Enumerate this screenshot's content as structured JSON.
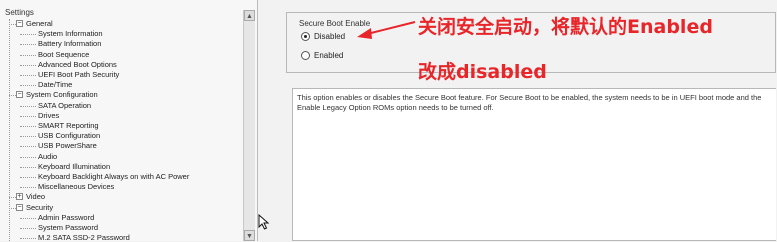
{
  "tree": {
    "title": "Settings",
    "items": [
      {
        "label": "General",
        "level": 0,
        "expander": "−"
      },
      {
        "label": "System Information",
        "level": 1
      },
      {
        "label": "Battery Information",
        "level": 1
      },
      {
        "label": "Boot Sequence",
        "level": 1
      },
      {
        "label": "Advanced Boot Options",
        "level": 1
      },
      {
        "label": "UEFI Boot Path Security",
        "level": 1
      },
      {
        "label": "Date/Time",
        "level": 1
      },
      {
        "label": "System Configuration",
        "level": 0,
        "expander": "−"
      },
      {
        "label": "SATA Operation",
        "level": 1
      },
      {
        "label": "Drives",
        "level": 1
      },
      {
        "label": "SMART Reporting",
        "level": 1
      },
      {
        "label": "USB Configuration",
        "level": 1
      },
      {
        "label": "USB PowerShare",
        "level": 1
      },
      {
        "label": "Audio",
        "level": 1
      },
      {
        "label": "Keyboard Illumination",
        "level": 1
      },
      {
        "label": "Keyboard Backlight Always on with AC Power",
        "level": 1
      },
      {
        "label": "Miscellaneous Devices",
        "level": 1
      },
      {
        "label": "Video",
        "level": 0,
        "expander": "+"
      },
      {
        "label": "Security",
        "level": 0,
        "expander": "−"
      },
      {
        "label": "Admin Password",
        "level": 1
      },
      {
        "label": "System Password",
        "level": 1
      },
      {
        "label": "M.2 SATA SSD-2 Password",
        "level": 1
      }
    ]
  },
  "secure_boot": {
    "group_title": "Secure Boot Enable",
    "options": [
      {
        "label": "Disabled",
        "checked": true
      },
      {
        "label": "Enabled",
        "checked": false
      }
    ],
    "description": "This option enables or disables the Secure Boot feature. For Secure Boot to be enabled, the system needs to be in UEFI boot mode and the Enable Legacy Option ROMs option needs to be turned off."
  },
  "annotation": {
    "line1": "关闭安全启动，将默认的Enabled",
    "line2": "改成disabled",
    "color": "#e8262a"
  }
}
